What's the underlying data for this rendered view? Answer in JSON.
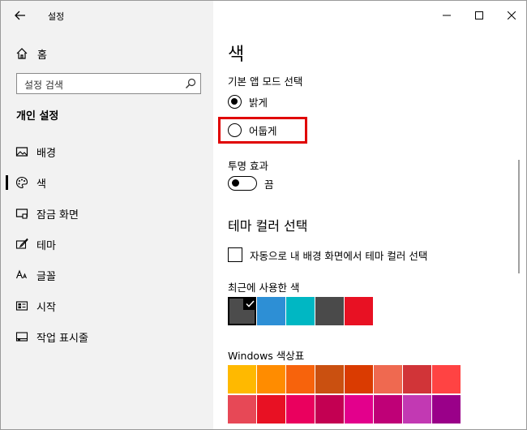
{
  "window": {
    "title": "설정"
  },
  "sidebar": {
    "home_label": "홈",
    "search_placeholder": "설정 검색",
    "section_title": "개인 설정",
    "items": [
      {
        "label": "배경",
        "icon": "image-icon"
      },
      {
        "label": "색",
        "icon": "palette-icon",
        "selected": true
      },
      {
        "label": "잠금 화면",
        "icon": "lock-screen-icon"
      },
      {
        "label": "테마",
        "icon": "theme-brush-icon"
      },
      {
        "label": "글꼴",
        "icon": "font-icon"
      },
      {
        "label": "시작",
        "icon": "start-icon"
      },
      {
        "label": "작업 표시줄",
        "icon": "taskbar-icon"
      }
    ]
  },
  "main": {
    "page_title": "색",
    "app_mode_label": "기본 앱 모드 선택",
    "mode_options": [
      {
        "label": "밝게",
        "checked": true
      },
      {
        "label": "어둡게",
        "checked": false
      }
    ],
    "transparency_label": "투명 효과",
    "transparency_state": "끔",
    "accent_heading": "테마 컬러 선택",
    "auto_accent_label": "자동으로 내 배경 화면에서 테마 컬러 선택",
    "recent_colors_label": "최근에 사용한 색",
    "recent_colors": [
      "#4c4c4c",
      "#2d8fd5",
      "#00b7c3",
      "#4a4a4a",
      "#e81123"
    ],
    "windows_palette_label": "Windows 색상표",
    "palette_row1": [
      "#ffb900",
      "#ff8c00",
      "#f7630c",
      "#ca5010",
      "#da3b01",
      "#ef6950",
      "#d13438",
      "#ff4343"
    ],
    "palette_row2": [
      "#e74856",
      "#e81123",
      "#ea005e",
      "#c30052",
      "#e3008c",
      "#bf0077",
      "#c239b3",
      "#9a0089"
    ]
  },
  "colors": {
    "highlight": "#e00000",
    "sidebar_bg": "#f2f2f2"
  }
}
